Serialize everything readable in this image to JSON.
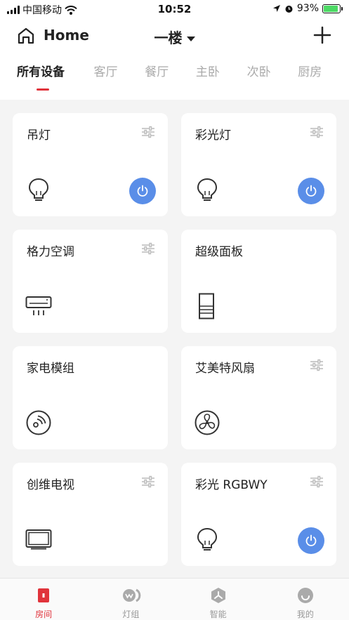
{
  "status_bar": {
    "carrier": "中国移动",
    "time": "10:52",
    "battery": "93%",
    "battery_level": 0.93
  },
  "header": {
    "title": "Home",
    "floor": "一楼"
  },
  "tabs": [
    "所有设备",
    "客厅",
    "餐厅",
    "主卧",
    "次卧",
    "厨房"
  ],
  "devices": [
    {
      "name": "吊灯",
      "icon": "bulb-icon",
      "has_power": true
    },
    {
      "name": "彩光灯",
      "icon": "bulb-icon",
      "has_power": true
    },
    {
      "name": "格力空调",
      "icon": "air-conditioner-icon",
      "has_power": false
    },
    {
      "name": "超级面板",
      "icon": "panel-icon",
      "has_power": false
    },
    {
      "name": "家电模组",
      "icon": "module-icon",
      "has_power": false
    },
    {
      "name": "艾美特风扇",
      "icon": "fan-icon",
      "has_power": false
    },
    {
      "name": "创维电视",
      "icon": "tv-icon",
      "has_power": false
    },
    {
      "name": "彩光 RGBWY",
      "icon": "bulb-icon",
      "has_power": true
    }
  ],
  "bottom_nav": [
    {
      "label": "房间",
      "icon": "room-icon",
      "active": true
    },
    {
      "label": "灯组",
      "icon": "light-group-icon",
      "active": false
    },
    {
      "label": "智能",
      "icon": "smart-icon",
      "active": false
    },
    {
      "label": "我的",
      "icon": "profile-icon",
      "active": false
    }
  ],
  "colors": {
    "accent": "#e0333b",
    "power_button": "#5a8ee8",
    "background": "#f4f4f4"
  }
}
